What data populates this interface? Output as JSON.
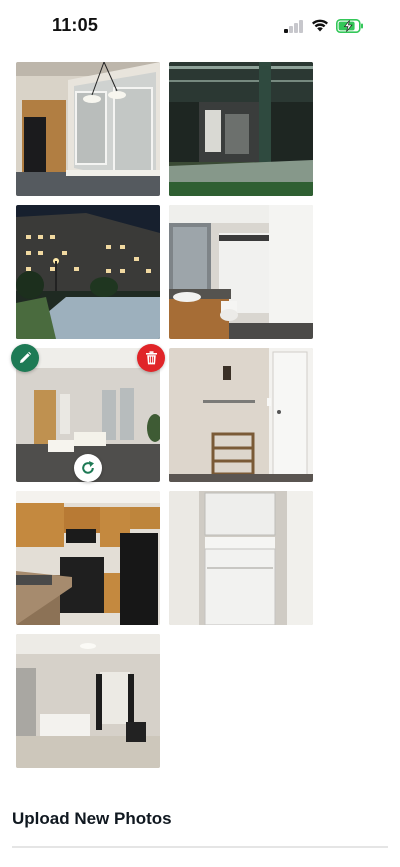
{
  "status_bar": {
    "time": "11:05",
    "signal_bars_active": 1,
    "icons": [
      "cellular-signal-icon",
      "wifi-icon",
      "battery-charging-icon"
    ],
    "battery_color": "#34c759"
  },
  "photos": [
    {
      "id": "photo-1",
      "scene": "kitchen-living"
    },
    {
      "id": "photo-2",
      "scene": "balcony-night"
    },
    {
      "id": "photo-3",
      "scene": "building-exterior-night"
    },
    {
      "id": "photo-4",
      "scene": "bathroom"
    },
    {
      "id": "photo-5",
      "scene": "living-room",
      "selected": true
    },
    {
      "id": "photo-6",
      "scene": "entry-shelf"
    },
    {
      "id": "photo-7",
      "scene": "kitchen"
    },
    {
      "id": "photo-8",
      "scene": "laundry"
    },
    {
      "id": "photo-9",
      "scene": "bedroom"
    }
  ],
  "photo_actions": {
    "edit_icon": "pencil-icon",
    "delete_icon": "trash-icon",
    "rotate_icon": "rotate-icon",
    "edit_color": "#1e7a55",
    "delete_color": "#e02428"
  },
  "upload": {
    "title": "Upload New Photos"
  }
}
